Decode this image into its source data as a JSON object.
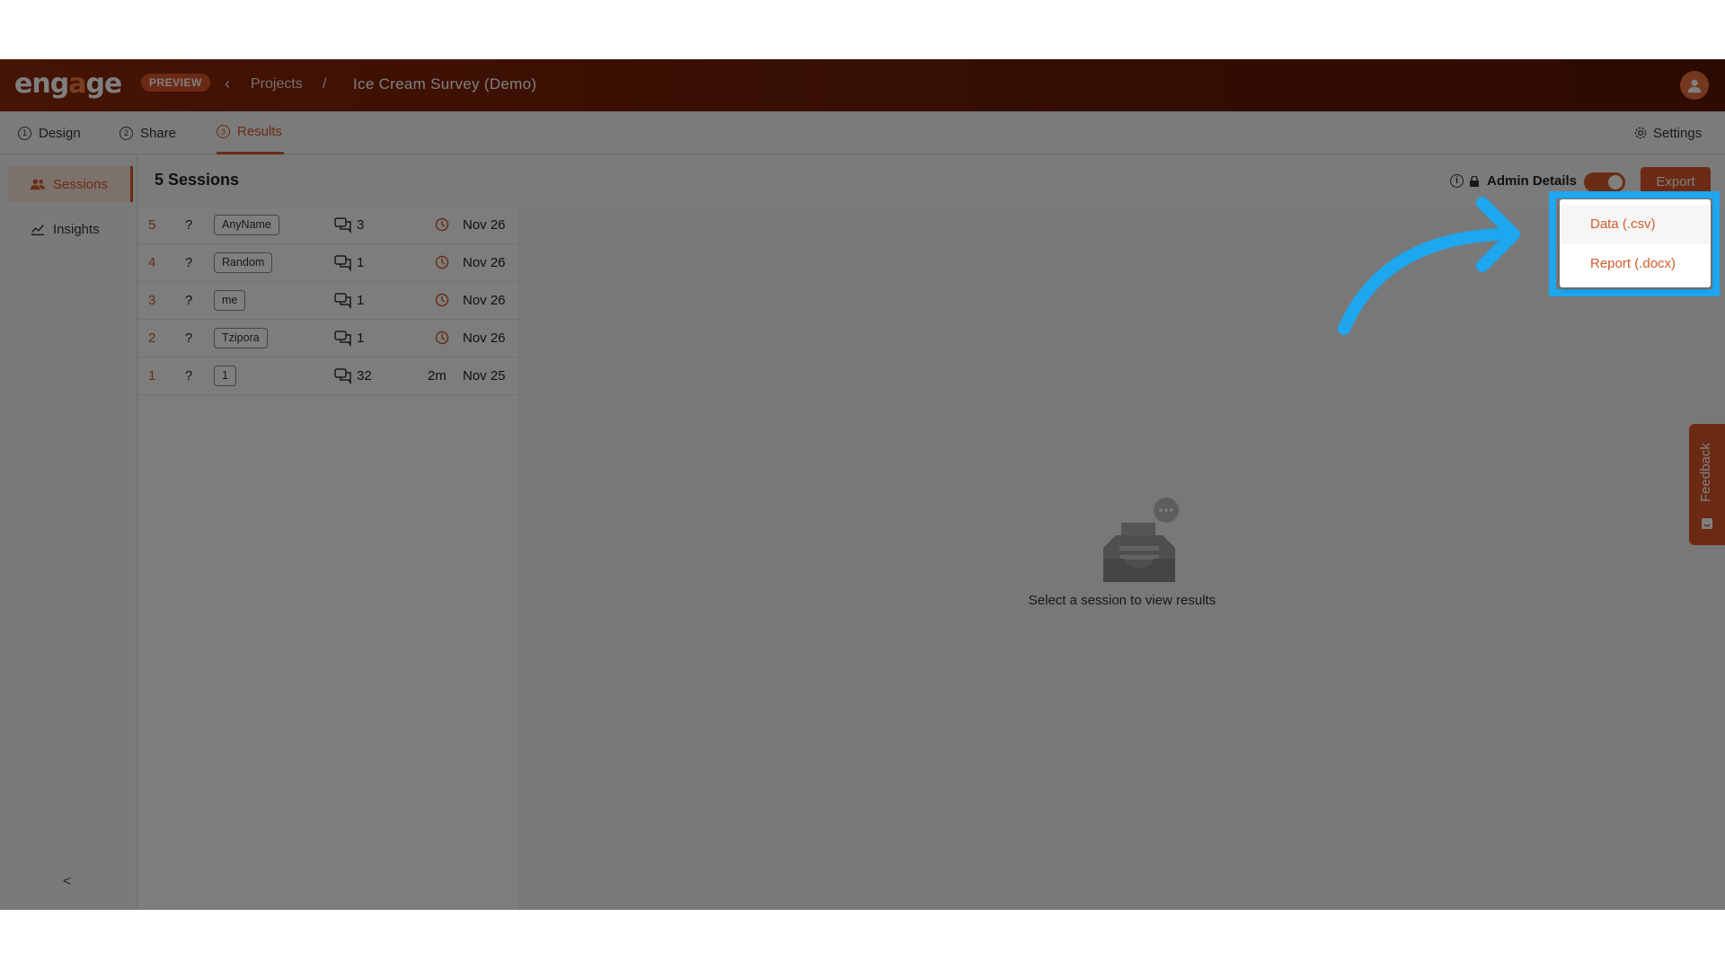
{
  "header": {
    "logo": "engage",
    "badge": "PREVIEW",
    "breadcrumb_parent": "Projects",
    "breadcrumb_separator": "/",
    "breadcrumb_current": "Ice Cream Survey (Demo)"
  },
  "tabs": [
    {
      "num": "1",
      "label": "Design"
    },
    {
      "num": "2",
      "label": "Share"
    },
    {
      "num": "3",
      "label": "Results"
    }
  ],
  "settings_label": "Settings",
  "nav": {
    "sessions": "Sessions",
    "insights": "Insights",
    "collapse": "<"
  },
  "list": {
    "title": "5 Sessions",
    "admin_label": "Admin Details",
    "export_label": "Export",
    "rows": [
      {
        "idx": "5",
        "q": "?",
        "name": "AnyName",
        "count": "3",
        "duration": "",
        "date": "Nov 26"
      },
      {
        "idx": "4",
        "q": "?",
        "name": "Random",
        "count": "1",
        "duration": "",
        "date": "Nov 26"
      },
      {
        "idx": "3",
        "q": "?",
        "name": "me",
        "count": "1",
        "duration": "",
        "date": "Nov 26"
      },
      {
        "idx": "2",
        "q": "?",
        "name": "Tzipora",
        "count": "1",
        "duration": "",
        "date": "Nov 26"
      },
      {
        "idx": "1",
        "q": "?",
        "name": "1",
        "count": "32",
        "duration": "2m",
        "date": "Nov 25"
      }
    ]
  },
  "empty_state": "Select a session to view results",
  "feedback_label": "Feedback",
  "export_menu": {
    "options": [
      "Data (.csv)",
      "Report (.docx)"
    ]
  },
  "colors": {
    "accent": "#d35a2a",
    "header_bg": "#6e1d06",
    "highlight": "#1ea6ee"
  }
}
